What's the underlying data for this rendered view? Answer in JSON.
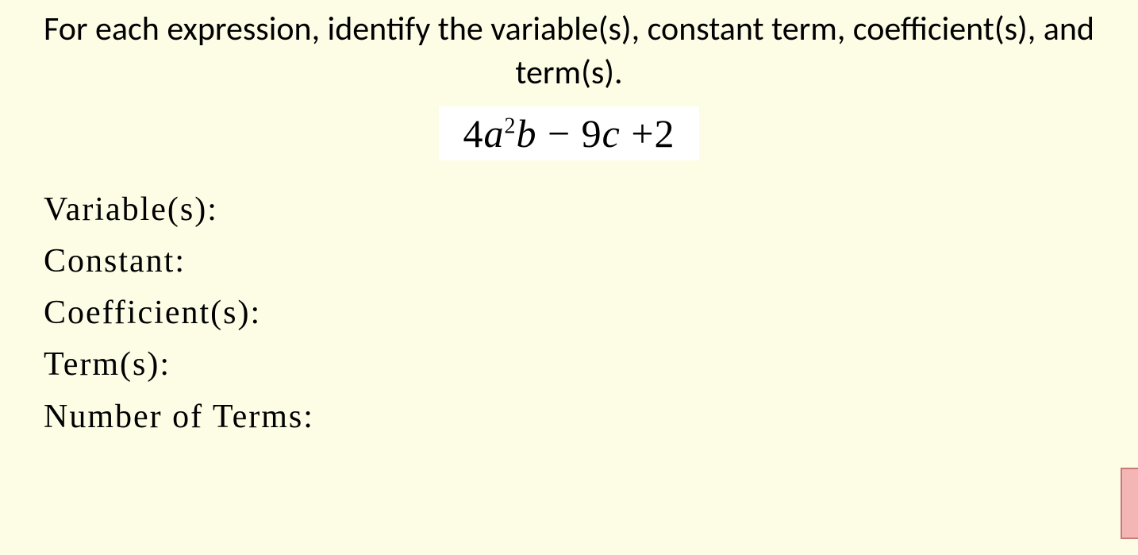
{
  "instruction": "For each expression, identify the variable(s), constant term, coefficient(s), and term(s).",
  "expression": {
    "coeff1": "4",
    "var1a": "a",
    "exp1": "2",
    "var1b": "b",
    "op1": " − ",
    "coeff2": "9",
    "var2": "c",
    "op2": " +",
    "const": "2"
  },
  "fields": {
    "variables": "Variable(s):",
    "constant": "Constant:",
    "coefficients": "Coefficient(s):",
    "terms": "Term(s):",
    "num_terms": "Number of Terms:"
  }
}
